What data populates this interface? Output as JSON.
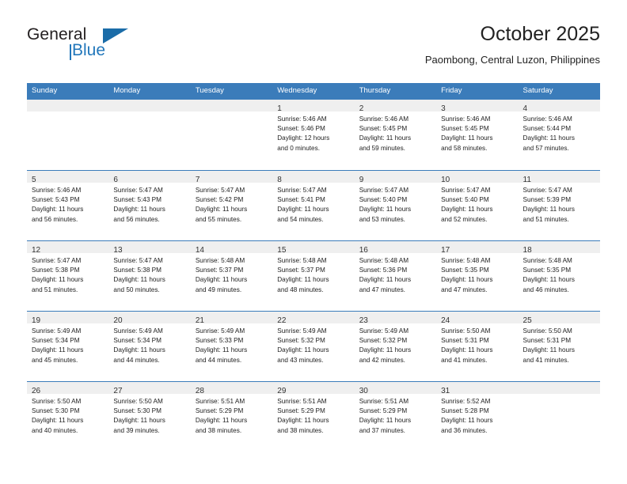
{
  "logo": {
    "word1": "General",
    "word2": "Blue",
    "triangle_icon": "triangle-icon",
    "accent_color": "#2277bb"
  },
  "header": {
    "title": "October 2025",
    "subtitle": "Paombong, Central Luzon, Philippines"
  },
  "theme": {
    "header_blue": "#3b7cba",
    "day_band_gray": "#efefef"
  },
  "weekdays": [
    "Sunday",
    "Monday",
    "Tuesday",
    "Wednesday",
    "Thursday",
    "Friday",
    "Saturday"
  ],
  "weeks": [
    [
      {
        "day": "",
        "empty": true
      },
      {
        "day": "",
        "empty": true
      },
      {
        "day": "",
        "empty": true
      },
      {
        "day": "1",
        "sunrise": "Sunrise: 5:46 AM",
        "sunset": "Sunset: 5:46 PM",
        "daylight1": "Daylight: 12 hours",
        "daylight2": "and 0 minutes."
      },
      {
        "day": "2",
        "sunrise": "Sunrise: 5:46 AM",
        "sunset": "Sunset: 5:45 PM",
        "daylight1": "Daylight: 11 hours",
        "daylight2": "and 59 minutes."
      },
      {
        "day": "3",
        "sunrise": "Sunrise: 5:46 AM",
        "sunset": "Sunset: 5:45 PM",
        "daylight1": "Daylight: 11 hours",
        "daylight2": "and 58 minutes."
      },
      {
        "day": "4",
        "sunrise": "Sunrise: 5:46 AM",
        "sunset": "Sunset: 5:44 PM",
        "daylight1": "Daylight: 11 hours",
        "daylight2": "and 57 minutes."
      }
    ],
    [
      {
        "day": "5",
        "sunrise": "Sunrise: 5:46 AM",
        "sunset": "Sunset: 5:43 PM",
        "daylight1": "Daylight: 11 hours",
        "daylight2": "and 56 minutes."
      },
      {
        "day": "6",
        "sunrise": "Sunrise: 5:47 AM",
        "sunset": "Sunset: 5:43 PM",
        "daylight1": "Daylight: 11 hours",
        "daylight2": "and 56 minutes."
      },
      {
        "day": "7",
        "sunrise": "Sunrise: 5:47 AM",
        "sunset": "Sunset: 5:42 PM",
        "daylight1": "Daylight: 11 hours",
        "daylight2": "and 55 minutes."
      },
      {
        "day": "8",
        "sunrise": "Sunrise: 5:47 AM",
        "sunset": "Sunset: 5:41 PM",
        "daylight1": "Daylight: 11 hours",
        "daylight2": "and 54 minutes."
      },
      {
        "day": "9",
        "sunrise": "Sunrise: 5:47 AM",
        "sunset": "Sunset: 5:40 PM",
        "daylight1": "Daylight: 11 hours",
        "daylight2": "and 53 minutes."
      },
      {
        "day": "10",
        "sunrise": "Sunrise: 5:47 AM",
        "sunset": "Sunset: 5:40 PM",
        "daylight1": "Daylight: 11 hours",
        "daylight2": "and 52 minutes."
      },
      {
        "day": "11",
        "sunrise": "Sunrise: 5:47 AM",
        "sunset": "Sunset: 5:39 PM",
        "daylight1": "Daylight: 11 hours",
        "daylight2": "and 51 minutes."
      }
    ],
    [
      {
        "day": "12",
        "sunrise": "Sunrise: 5:47 AM",
        "sunset": "Sunset: 5:38 PM",
        "daylight1": "Daylight: 11 hours",
        "daylight2": "and 51 minutes."
      },
      {
        "day": "13",
        "sunrise": "Sunrise: 5:47 AM",
        "sunset": "Sunset: 5:38 PM",
        "daylight1": "Daylight: 11 hours",
        "daylight2": "and 50 minutes."
      },
      {
        "day": "14",
        "sunrise": "Sunrise: 5:48 AM",
        "sunset": "Sunset: 5:37 PM",
        "daylight1": "Daylight: 11 hours",
        "daylight2": "and 49 minutes."
      },
      {
        "day": "15",
        "sunrise": "Sunrise: 5:48 AM",
        "sunset": "Sunset: 5:37 PM",
        "daylight1": "Daylight: 11 hours",
        "daylight2": "and 48 minutes."
      },
      {
        "day": "16",
        "sunrise": "Sunrise: 5:48 AM",
        "sunset": "Sunset: 5:36 PM",
        "daylight1": "Daylight: 11 hours",
        "daylight2": "and 47 minutes."
      },
      {
        "day": "17",
        "sunrise": "Sunrise: 5:48 AM",
        "sunset": "Sunset: 5:35 PM",
        "daylight1": "Daylight: 11 hours",
        "daylight2": "and 47 minutes."
      },
      {
        "day": "18",
        "sunrise": "Sunrise: 5:48 AM",
        "sunset": "Sunset: 5:35 PM",
        "daylight1": "Daylight: 11 hours",
        "daylight2": "and 46 minutes."
      }
    ],
    [
      {
        "day": "19",
        "sunrise": "Sunrise: 5:49 AM",
        "sunset": "Sunset: 5:34 PM",
        "daylight1": "Daylight: 11 hours",
        "daylight2": "and 45 minutes."
      },
      {
        "day": "20",
        "sunrise": "Sunrise: 5:49 AM",
        "sunset": "Sunset: 5:34 PM",
        "daylight1": "Daylight: 11 hours",
        "daylight2": "and 44 minutes."
      },
      {
        "day": "21",
        "sunrise": "Sunrise: 5:49 AM",
        "sunset": "Sunset: 5:33 PM",
        "daylight1": "Daylight: 11 hours",
        "daylight2": "and 44 minutes."
      },
      {
        "day": "22",
        "sunrise": "Sunrise: 5:49 AM",
        "sunset": "Sunset: 5:32 PM",
        "daylight1": "Daylight: 11 hours",
        "daylight2": "and 43 minutes."
      },
      {
        "day": "23",
        "sunrise": "Sunrise: 5:49 AM",
        "sunset": "Sunset: 5:32 PM",
        "daylight1": "Daylight: 11 hours",
        "daylight2": "and 42 minutes."
      },
      {
        "day": "24",
        "sunrise": "Sunrise: 5:50 AM",
        "sunset": "Sunset: 5:31 PM",
        "daylight1": "Daylight: 11 hours",
        "daylight2": "and 41 minutes."
      },
      {
        "day": "25",
        "sunrise": "Sunrise: 5:50 AM",
        "sunset": "Sunset: 5:31 PM",
        "daylight1": "Daylight: 11 hours",
        "daylight2": "and 41 minutes."
      }
    ],
    [
      {
        "day": "26",
        "sunrise": "Sunrise: 5:50 AM",
        "sunset": "Sunset: 5:30 PM",
        "daylight1": "Daylight: 11 hours",
        "daylight2": "and 40 minutes."
      },
      {
        "day": "27",
        "sunrise": "Sunrise: 5:50 AM",
        "sunset": "Sunset: 5:30 PM",
        "daylight1": "Daylight: 11 hours",
        "daylight2": "and 39 minutes."
      },
      {
        "day": "28",
        "sunrise": "Sunrise: 5:51 AM",
        "sunset": "Sunset: 5:29 PM",
        "daylight1": "Daylight: 11 hours",
        "daylight2": "and 38 minutes."
      },
      {
        "day": "29",
        "sunrise": "Sunrise: 5:51 AM",
        "sunset": "Sunset: 5:29 PM",
        "daylight1": "Daylight: 11 hours",
        "daylight2": "and 38 minutes."
      },
      {
        "day": "30",
        "sunrise": "Sunrise: 5:51 AM",
        "sunset": "Sunset: 5:29 PM",
        "daylight1": "Daylight: 11 hours",
        "daylight2": "and 37 minutes."
      },
      {
        "day": "31",
        "sunrise": "Sunrise: 5:52 AM",
        "sunset": "Sunset: 5:28 PM",
        "daylight1": "Daylight: 11 hours",
        "daylight2": "and 36 minutes."
      },
      {
        "day": "",
        "empty": true
      }
    ]
  ]
}
